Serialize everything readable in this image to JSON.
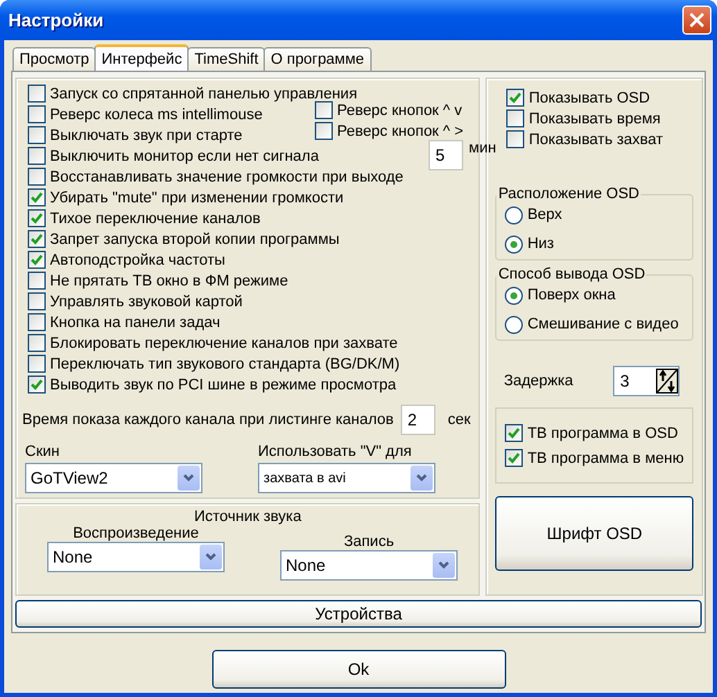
{
  "window": {
    "title": "Настройки"
  },
  "tabs": [
    {
      "label": "Просмотр",
      "selected": false
    },
    {
      "label": "Интерфейс",
      "selected": true
    },
    {
      "label": "TimeShift",
      "selected": false
    },
    {
      "label": "О программе",
      "selected": false
    }
  ],
  "options": [
    {
      "label": "Запуск со спрятанной панелью управления",
      "checked": false
    },
    {
      "label": "Реверс колеса ms intellimouse",
      "checked": false,
      "side": {
        "kind": "checkbox",
        "label": "Реверс кнопок ^ v",
        "checked": false
      }
    },
    {
      "label": "Выключать звук при старте",
      "checked": false,
      "side": {
        "kind": "checkbox",
        "label": "Реверс кнопок ^ >",
        "checked": false
      }
    },
    {
      "label": "Выключить монитор если нет сигнала",
      "checked": false,
      "side": {
        "kind": "number",
        "value": "5",
        "unit": "мин"
      }
    },
    {
      "label": "Восстанавливать значение громкости при выходе",
      "checked": false
    },
    {
      "label": "Убирать \"mute\" при изменении громкости",
      "checked": true
    },
    {
      "label": "Тихое переключение каналов",
      "checked": true
    },
    {
      "label": "Запрет запуска второй копии программы",
      "checked": true
    },
    {
      "label": "Автоподстройка частоты",
      "checked": true
    },
    {
      "label": "Не прятать ТВ окно в ФМ режиме",
      "checked": false
    },
    {
      "label": "Управлять звуковой картой",
      "checked": false
    },
    {
      "label": "Кнопка на панели задач",
      "checked": false
    },
    {
      "label": "Блокировать переключение каналов при захвате",
      "checked": false
    },
    {
      "label": "Переключать тип звукового стандарта (BG/DK/M)",
      "checked": false
    },
    {
      "label": "Выводить звук по PCI шине в режиме просмотра",
      "checked": true
    }
  ],
  "listing_time": {
    "label": "Время показа каждого канала при листинге каналов",
    "value": "2",
    "unit": "сек"
  },
  "skin": {
    "label": "Скин",
    "value": "GoTView2"
  },
  "v_key": {
    "label": "Использовать  \"V\" для",
    "value": "захвата в avi"
  },
  "sound_source": {
    "title": "Источник звука",
    "playback": {
      "label": "Воспроизведение",
      "value": "None"
    },
    "record": {
      "label": "Запись",
      "value": "None"
    }
  },
  "osd_options": [
    {
      "label": "Показывать OSD",
      "checked": true
    },
    {
      "label": "Показывать время",
      "checked": false
    },
    {
      "label": "Показывать захват",
      "checked": false
    }
  ],
  "osd_position": {
    "title": "Расположение OSD",
    "options": [
      {
        "label": "Верх",
        "selected": false
      },
      {
        "label": "Низ",
        "selected": true
      }
    ]
  },
  "osd_mode": {
    "title": "Способ вывода OSD",
    "options": [
      {
        "label": "Поверх окна",
        "selected": true
      },
      {
        "label": "Смешивание с видео",
        "selected": false
      }
    ]
  },
  "delay": {
    "label": "Задержка",
    "value": "3"
  },
  "tv_program": [
    {
      "label": "ТВ программа в OSD",
      "checked": true
    },
    {
      "label": "ТВ программа в меню",
      "checked": true
    }
  ],
  "font_button": "Шрифт OSD",
  "devices_button": "Устройства",
  "ok_button": "Ok"
}
